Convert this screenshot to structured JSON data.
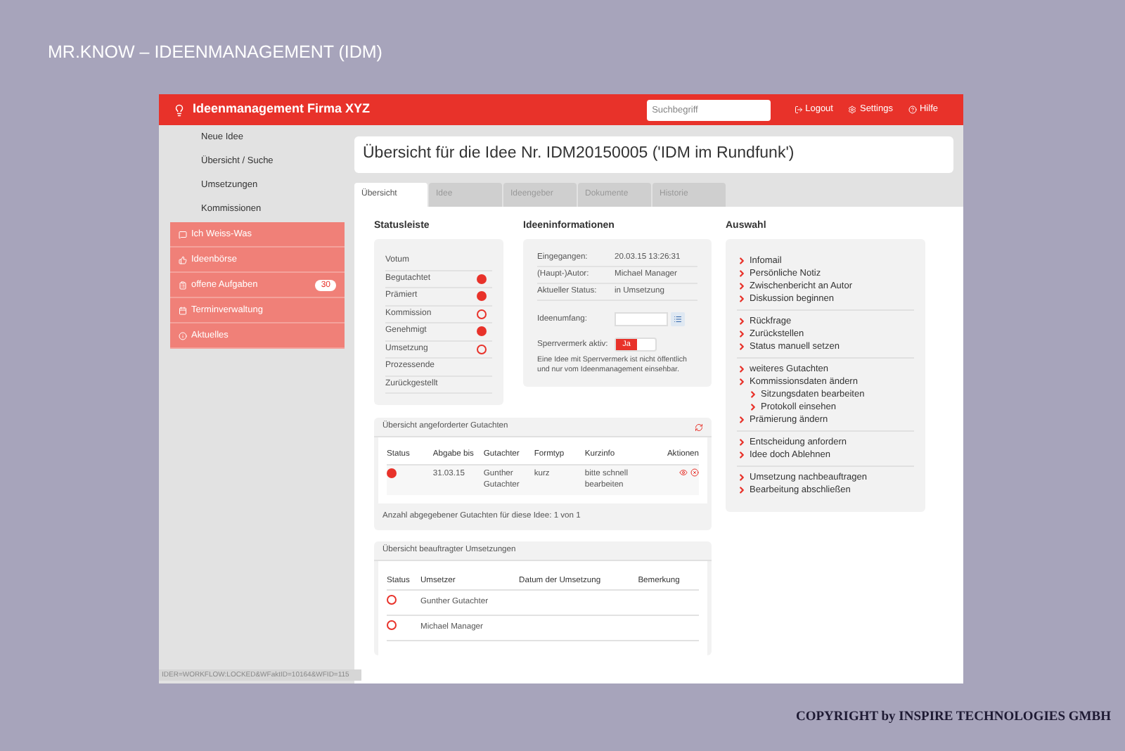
{
  "slide_title": "MR.KNOW – IDEENMANAGEMENT (IDM)",
  "app": {
    "title": "Ideenmanagement Firma XYZ",
    "search": {
      "placeholder": "Suchbegriff"
    },
    "header_links": [
      {
        "label": "Logout",
        "kind": "logout"
      },
      {
        "label": "Settings",
        "kind": "settings"
      },
      {
        "label": "Hilfe",
        "kind": "help"
      }
    ]
  },
  "sidebar": {
    "items": [
      {
        "label": "Neue Idee"
      },
      {
        "label": "Übersicht / Suche"
      },
      {
        "label": "Umsetzungen"
      },
      {
        "label": "Kommissionen"
      }
    ],
    "groups": [
      {
        "label": "Ich Weiss-Was",
        "kind": "chat"
      },
      {
        "label": "Ideenbörse",
        "kind": "thumb"
      },
      {
        "label": "offene Aufgaben",
        "kind": "tasks",
        "badge": "30"
      },
      {
        "label": "Terminverwaltung",
        "kind": "calendar"
      },
      {
        "label": "Aktuelles",
        "kind": "info"
      }
    ],
    "footer": "IDER=WORKFLOW:LOCKED&WFaktID=10164&WFID=115"
  },
  "page_title": "Übersicht für die Idee Nr. IDM20150005 ('IDM im Rundfunk')",
  "tabs": [
    {
      "label": "Übersicht",
      "selected": true
    },
    {
      "label": "Idee",
      "selected": false
    },
    {
      "label": "Ideengeber",
      "selected": false
    },
    {
      "label": "Dokumente",
      "selected": false
    },
    {
      "label": "Historie",
      "selected": false
    }
  ],
  "statusleiste": {
    "title": "Statusleiste",
    "steps": [
      {
        "label": "Votum",
        "kind": "none"
      },
      {
        "label": "Begutachtet",
        "kind": "done"
      },
      {
        "label": "Prämiert",
        "kind": "done"
      },
      {
        "label": "Kommission",
        "kind": "open"
      },
      {
        "label": "Genehmigt",
        "kind": "done"
      },
      {
        "label": "Umsetzung",
        "kind": "open"
      },
      {
        "label": "Prozessende",
        "kind": "none"
      },
      {
        "label": "Zurückgestellt",
        "kind": "none"
      }
    ]
  },
  "ideeninformationen": {
    "title": "Ideeninformationen",
    "fields": [
      {
        "label": "Eingegangen:",
        "value": "20.03.15 13:26:31"
      },
      {
        "label": "(Haupt-)Autor:",
        "value": "Michael Manager"
      },
      {
        "label": "Aktueller Status:",
        "value": "in Umsetzung"
      }
    ],
    "umfang_label": "Ideenumfang:",
    "sperrvermerk": {
      "label": "Sperrvermerk aktiv:",
      "on": true,
      "on_text": "Ja"
    },
    "note": "Eine Idee mit Sperrvermerk ist nicht öffentlich und nur vom Ideenmanagement einsehbar."
  },
  "auswahl": {
    "title": "Auswahl",
    "groups": [
      [
        {
          "label": "Infomail"
        },
        {
          "label": "Persönliche Notiz"
        },
        {
          "label": "Zwischenbericht an Autor"
        },
        {
          "label": "Diskussion beginnen"
        }
      ],
      [
        {
          "label": "Rückfrage"
        },
        {
          "label": "Zurückstellen"
        },
        {
          "label": "Status manuell setzen"
        }
      ],
      [
        {
          "label": "weiteres Gutachten"
        },
        {
          "label": "Kommissionsdaten ändern",
          "children": [
            {
              "label": "Sitzungsdaten bearbeiten"
            },
            {
              "label": "Protokoll einsehen"
            }
          ]
        },
        {
          "label": "Prämierung ändern"
        }
      ],
      [
        {
          "label": "Entscheidung anfordern"
        },
        {
          "label": "Idee doch Ablehnen"
        }
      ],
      [
        {
          "label": "Umsetzung nachbeauftragen"
        },
        {
          "label": "Bearbeitung abschließen"
        }
      ]
    ]
  },
  "gutachten": {
    "title": "Übersicht angeforderter Gutachten",
    "columns": [
      "Status",
      "Abgabe bis",
      "Gutachter",
      "Formtyp",
      "Kurzinfo",
      "Aktionen"
    ],
    "rows": [
      {
        "kind": "done",
        "cells": [
          "",
          "31.03.15",
          "Gunther Gutachter",
          "kurz",
          "bitte schnell bearbeiten"
        ]
      }
    ],
    "footer": "Anzahl abgegebener Gutachten für diese Idee: 1 von 1"
  },
  "umsetzungen": {
    "title": "Übersicht beauftragter Umsetzungen",
    "columns": [
      "Status",
      "Umsetzer",
      "Datum der Umsetzung",
      "Bemerkung"
    ],
    "rows": [
      {
        "kind": "open",
        "cells": [
          "",
          "Gunther Gutachter"
        ]
      },
      {
        "kind": "open",
        "cells": [
          "",
          "Michael Manager"
        ]
      }
    ]
  },
  "copyright": "COPYRIGHT by INSPIRE TECHNOLOGIES GMBH"
}
